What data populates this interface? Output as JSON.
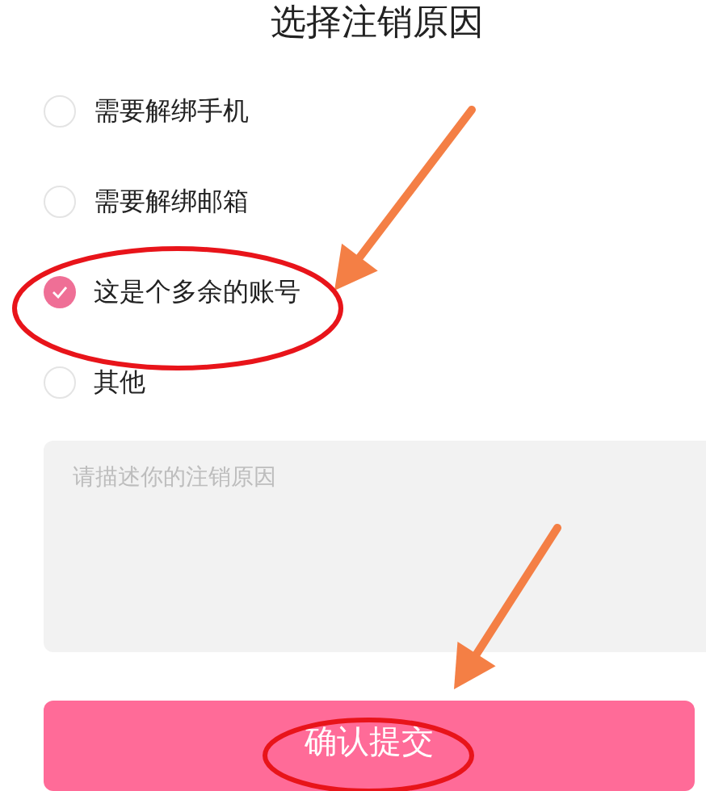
{
  "title": "选择注销原因",
  "options": [
    {
      "label": "需要解绑手机",
      "selected": false
    },
    {
      "label": "需要解绑邮箱",
      "selected": false
    },
    {
      "label": "这是个多余的账号",
      "selected": true
    },
    {
      "label": "其他",
      "selected": false
    }
  ],
  "reason_field": {
    "placeholder": "请描述你的注销原因"
  },
  "submit_button": "确认提交"
}
